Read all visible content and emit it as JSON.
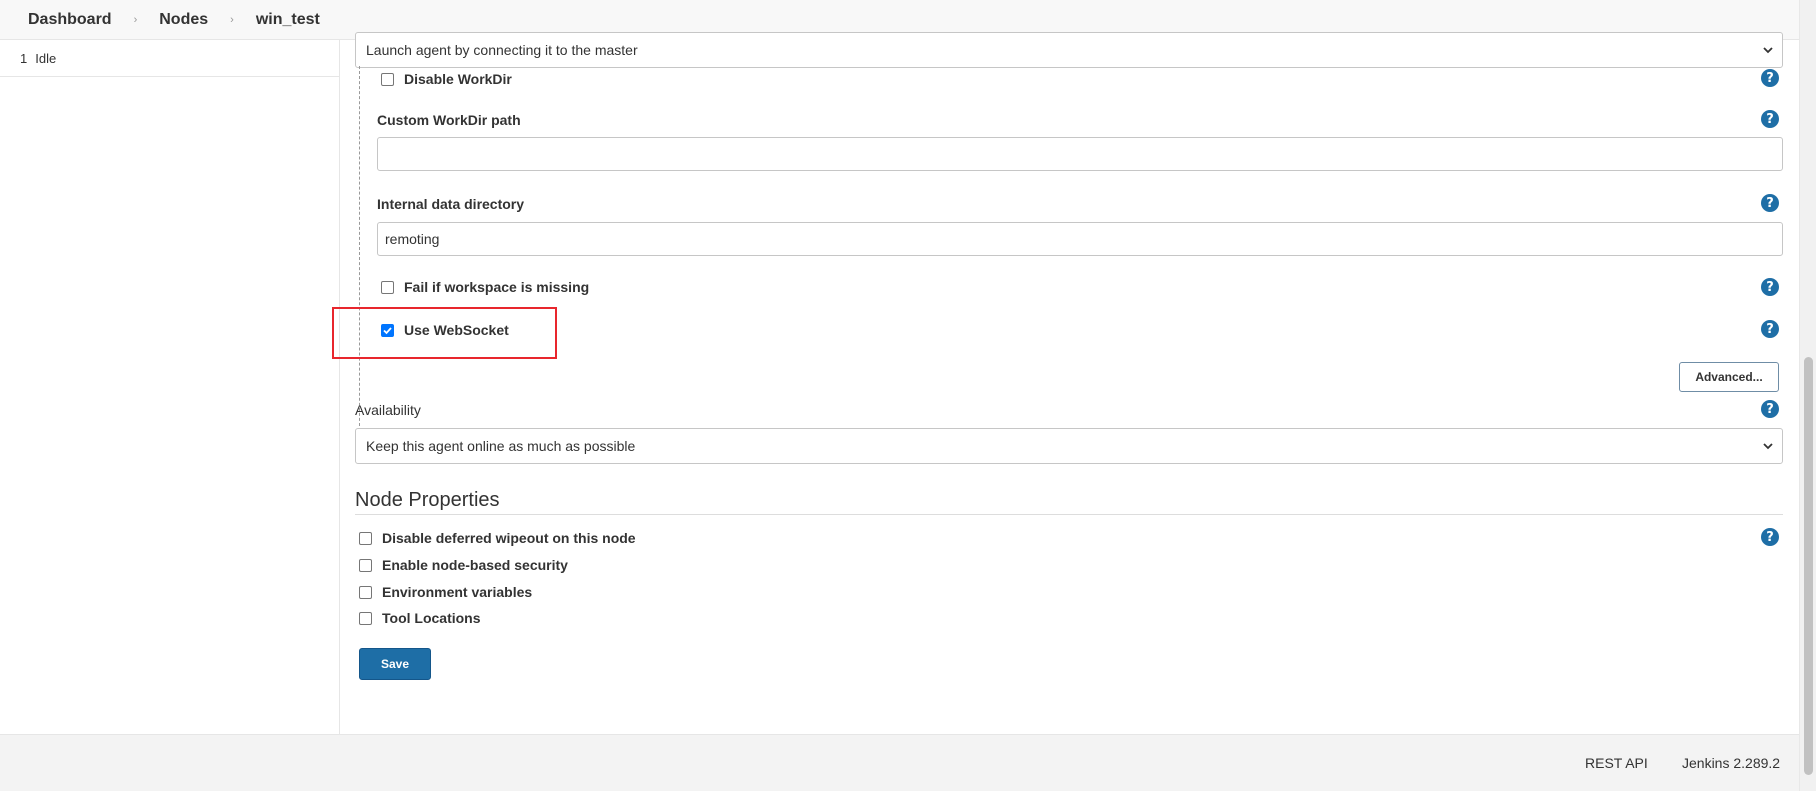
{
  "breadcrumb": {
    "items": [
      "Dashboard",
      "Nodes",
      "win_test"
    ],
    "separator": "›"
  },
  "sidebar": {
    "executor_number": "1",
    "executor_status": "Idle"
  },
  "launch": {
    "method_value": "Launch agent by connecting it to the master"
  },
  "options": {
    "disable_workdir": "Disable WorkDir",
    "custom_workdir_label": "Custom WorkDir path",
    "custom_workdir_value": "",
    "internal_dir_label": "Internal data directory",
    "internal_dir_value": "remoting",
    "fail_if_missing": "Fail if workspace is missing",
    "use_websocket": "Use WebSocket",
    "use_websocket_checked": true,
    "advanced_button": "Advanced..."
  },
  "availability": {
    "label": "Availability",
    "value": "Keep this agent online as much as possible"
  },
  "node_properties": {
    "heading": "Node Properties",
    "items": [
      "Disable deferred wipeout on this node",
      "Enable node-based security",
      "Environment variables",
      "Tool Locations"
    ]
  },
  "save_button": "Save",
  "help_glyph": "?",
  "footer": {
    "rest_api": "REST API",
    "version": "Jenkins 2.289.2"
  },
  "colors": {
    "primary": "#1e6ea6",
    "highlight": "#e8262d",
    "checkbox_checked": "#0075ff"
  }
}
